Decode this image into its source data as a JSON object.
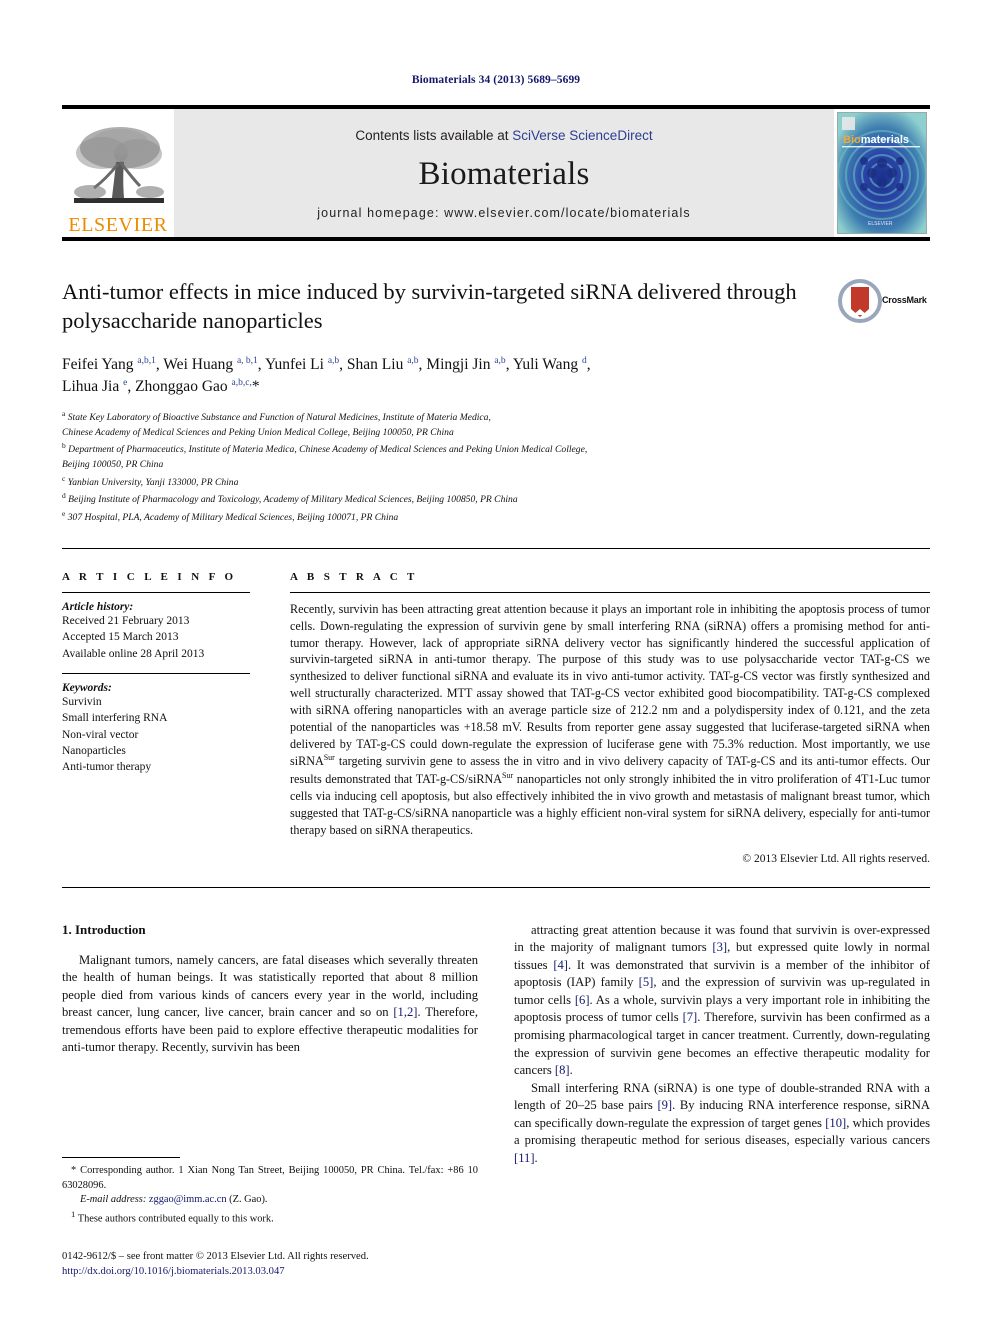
{
  "running_head": "Biomaterials 34 (2013) 5689–5699",
  "banner": {
    "publisher": "ELSEVIER",
    "contents_prefix": "Contents lists available at ",
    "contents_link": "SciVerse ScienceDirect",
    "journal_name": "Biomaterials",
    "homepage": "journal homepage: www.elsevier.com/locate/biomaterials",
    "cover_label": "Biomaterials"
  },
  "article": {
    "title": "Anti-tumor effects in mice induced by survivin-targeted siRNA delivered through polysaccharide nanoparticles",
    "crossmark_label": "CrossMark",
    "authors_line1": "Feifei Yang <sup>a,b,1</sup>, Wei Huang <sup>a, b,1</sup>, Yunfei Li <sup>a,b</sup>, Shan Liu <sup>a,b</sup>, Mingji Jin <sup>a,b</sup>, Yuli Wang <sup>d</sup>,",
    "authors_line2": "Lihua Jia <sup>e</sup>, Zhonggao Gao <sup>a,b,c,</sup>*",
    "affiliations": [
      "<sup>a</sup> State Key Laboratory of Bioactive Substance and Function of Natural Medicines, Institute of Materia Medica,",
      "Chinese Academy of Medical Sciences and Peking Union Medical College, Beijing 100050, PR China",
      "<sup>b</sup> Department of Pharmaceutics, Institute of Materia Medica, Chinese Academy of Medical Sciences and Peking Union Medical College,",
      "Beijing 100050, PR China",
      "<sup>c</sup> Yanbian University, Yanji 133000, PR China",
      "<sup>d</sup> Beijing Institute of Pharmacology and Toxicology, Academy of Military Medical Sciences, Beijing 100850, PR China",
      "<sup>e</sup> 307 Hospital, PLA, Academy of Military Medical Sciences, Beijing 100071, PR China"
    ]
  },
  "article_info": {
    "heading": "A R T I C L E   I N F O",
    "history_label": "Article history:",
    "history": [
      "Received 21 February 2013",
      "Accepted 15 March 2013",
      "Available online 28 April 2013"
    ],
    "keywords_label": "Keywords:",
    "keywords": [
      "Survivin",
      "Small interfering RNA",
      "Non-viral vector",
      "Nanoparticles",
      "Anti-tumor therapy"
    ]
  },
  "abstract": {
    "heading": "A B S T R A C T",
    "text": "Recently, survivin has been attracting great attention because it plays an important role in inhibiting the apoptosis process of tumor cells. Down-regulating the expression of survivin gene by small interfering RNA (siRNA) offers a promising method for anti-tumor therapy. However, lack of appropriate siRNA delivery vector has significantly hindered the successful application of survivin-targeted siRNA in anti-tumor therapy. The purpose of this study was to use polysaccharide vector TAT-g-CS we synthesized to deliver functional siRNA and evaluate its in vivo anti-tumor activity. TAT-g-CS vector was firstly synthesized and well structurally characterized. MTT assay showed that TAT-g-CS vector exhibited good biocompatibility. TAT-g-CS complexed with siRNA offering nanoparticles with an average particle size of 212.2 nm and a polydispersity index of 0.121, and the zeta potential of the nanoparticles was +18.58 mV. Results from reporter gene assay suggested that luciferase-targeted siRNA when delivered by TAT-g-CS could down-regulate the expression of luciferase gene with 75.3% reduction. Most importantly, we use siRNA<sup>Sur</sup> targeting survivin gene to assess the in vitro and in vivo delivery capacity of TAT-g-CS and its anti-tumor effects. Our results demonstrated that TAT-g-CS/siRNA<sup>Sur</sup> nanoparticles not only strongly inhibited the in vitro proliferation of 4T1-Luc tumor cells via inducing cell apoptosis, but also effectively inhibited the in vivo growth and metastasis of malignant breast tumor, which suggested that TAT-g-CS/siRNA nanoparticle was a highly efficient non-viral system for siRNA delivery, especially for anti-tumor therapy based on siRNA therapeutics.",
    "copyright": "© 2013 Elsevier Ltd. All rights reserved."
  },
  "introduction": {
    "heading": "1. Introduction",
    "left_paragraph": "Malignant tumors, namely cancers, are fatal diseases which severally threaten the health of human beings. It was statistically reported that about 8 million people died from various kinds of cancers every year in the world, including breast cancer, lung cancer, live cancer, brain cancer and so on <span class=\"ref\">[1,2]</span>. Therefore, tremendous efforts have been paid to explore effective therapeutic modalities for anti-tumor therapy. Recently, survivin has been",
    "right_paragraph_1": "attracting great attention because it was found that survivin is over-expressed in the majority of malignant tumors <span class=\"ref\">[3]</span>, but expressed quite lowly in normal tissues <span class=\"ref\">[4]</span>. It was demonstrated that survivin is a member of the inhibitor of apoptosis (IAP) family <span class=\"ref\">[5]</span>, and the expression of survivin was up-regulated in tumor cells <span class=\"ref\">[6]</span>. As a whole, survivin plays a very important role in inhibiting the apoptosis process of tumor cells <span class=\"ref\">[7]</span>. Therefore, survivin has been confirmed as a promising pharmacological target in cancer treatment. Currently, down-regulating the expression of survivin gene becomes an effective therapeutic modality for cancers <span class=\"ref\">[8]</span>.",
    "right_paragraph_2": "Small interfering RNA (siRNA) is one type of double-stranded RNA with a length of 20–25 base pairs <span class=\"ref\">[9]</span>. By inducing RNA interference response, siRNA can specifically down-regulate the expression of target genes <span class=\"ref\">[10]</span>, which provides a promising therapeutic method for serious diseases, especially various cancers <span class=\"ref\">[11]</span>."
  },
  "footnotes": {
    "corresponding": "* Corresponding author. 1 Xian Nong Tan Street, Beijing 100050, PR China. Tel./fax: +86 10 63028096.",
    "email_label": "E-mail address:",
    "email": "zggao@imm.ac.cn",
    "email_suffix": "(Z. Gao).",
    "equal_contrib": "<sup>1</sup> These authors contributed equally to this work."
  },
  "imprint": {
    "issn_line": "0142-9612/$ – see front matter © 2013 Elsevier Ltd. All rights reserved.",
    "doi": "http://dx.doi.org/10.1016/j.biomaterials.2013.03.047"
  },
  "colors": {
    "link_blue": "#2b3f91",
    "ref_blue": "#14186b",
    "elsevier_orange": "#ed8b00",
    "banner_gray": "#e8e8e8"
  }
}
